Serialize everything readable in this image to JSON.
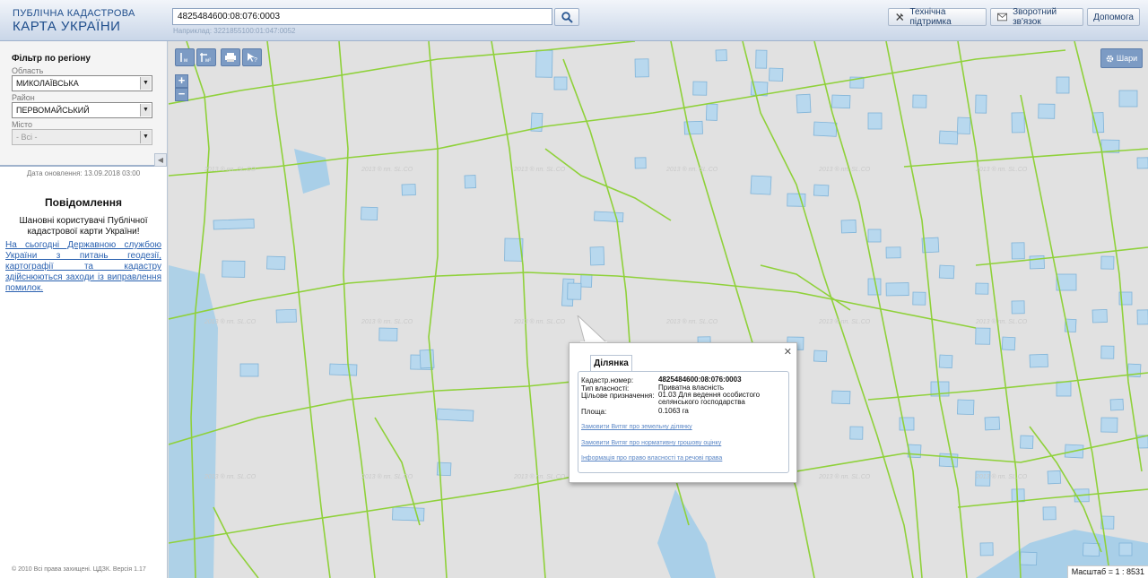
{
  "header": {
    "logo_line1": "ПУБЛІЧНА КАДАСТРОВА",
    "logo_line2": "КАРТА УКРАЇНИ",
    "search_value": "4825484600:08:076:0003",
    "example": "Наприклад: 3221855100:01:047:0052",
    "buttons": [
      {
        "label": "Технічна підтримка",
        "icon": "wrench-icon"
      },
      {
        "label": "Зворотний зв'язок",
        "icon": "mail-icon"
      },
      {
        "label": "Допомога",
        "icon": ""
      }
    ]
  },
  "filter": {
    "title": "Фільтр по регіону",
    "region_label": "Область",
    "region_value": "МИКОЛАЇВСЬКА",
    "district_label": "Район",
    "district_value": "ПЕРВОМАЙСЬКИЙ",
    "city_label": "Місто",
    "city_value": "- Всі -"
  },
  "update_text": "Дата оновлення: 13.09.2018 03:00",
  "notice": {
    "title": "Повідомлення",
    "text": "Шановні користувачі Публічної кадастрової карти України!",
    "link": "На сьогодні Державною службою України з питань геодезії, картографії та кадастру здійснюються заходи із виправлення помилок."
  },
  "copyright": "© 2010 Всі права захищені. ЦДЗК. Версія 1.17",
  "map": {
    "layers_label": "Шари",
    "scale_text": "Масштаб = 1 : 8531",
    "watermark": "2013 ® пп. SL.CO",
    "colors": {
      "lines": "#8fd13a",
      "parcels": "#b8d8ee",
      "water": "#a9cfe8"
    }
  },
  "popup": {
    "tab": "Ділянка",
    "rows": [
      {
        "key": "Кадастр.номер:",
        "value": "4825484600:08:076:0003"
      },
      {
        "key": "Тип власності:",
        "value": "Приватна власність"
      },
      {
        "key": "Цільове призначення:",
        "value": "01.03 Для ведення особистого селянського господарства"
      },
      {
        "key": "Площа:",
        "value": "0.1063 га"
      }
    ],
    "links": [
      "Замовити Витяг про земельну ділянку",
      "Замовити Витяг про нормативну грошову оцінку",
      "Інформація про право власності та речові права"
    ]
  }
}
